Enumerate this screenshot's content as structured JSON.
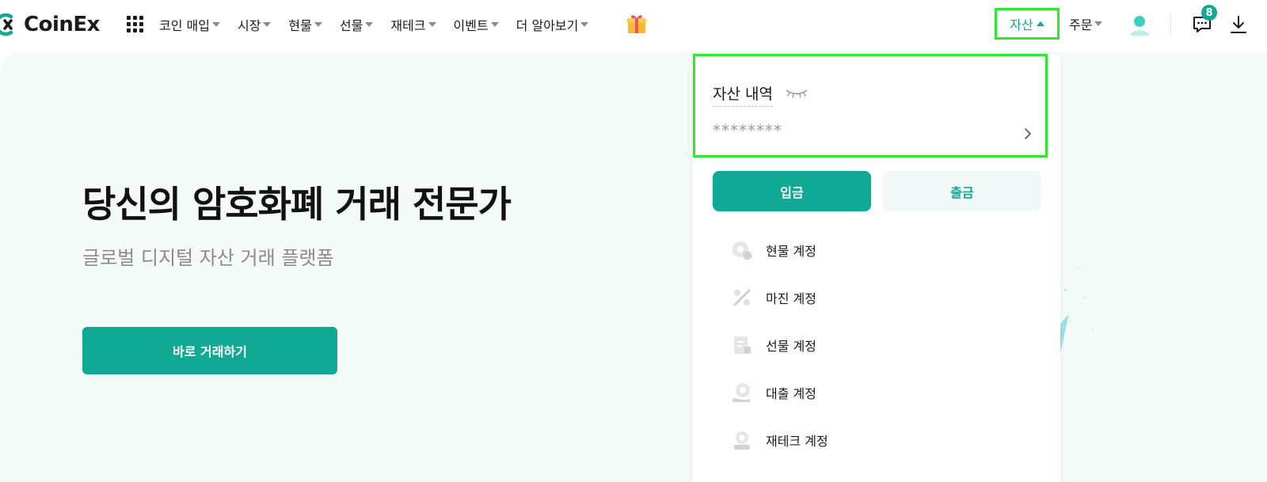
{
  "brand": {
    "name": "CoinEx",
    "accent": "#10a994"
  },
  "nav": {
    "items": [
      {
        "label": "코인 매입"
      },
      {
        "label": "시장"
      },
      {
        "label": "현물"
      },
      {
        "label": "선물"
      },
      {
        "label": "재테크"
      },
      {
        "label": "이벤트"
      },
      {
        "label": "더 알아보기"
      }
    ],
    "gift_icon": "gift-icon",
    "grid_icon": "apps-grid-icon"
  },
  "header_right": {
    "assets_label": "자산",
    "orders_label": "주문",
    "chat_badge": "8",
    "icons": [
      "avatar-icon",
      "chat-icon",
      "download-icon"
    ]
  },
  "hero": {
    "title": "당신의 암호화폐 거래 전문가",
    "subtitle": "글로벌 디지털 자산 거래 플랫폼",
    "cta_label": "바로 거래하기"
  },
  "assets_dropdown": {
    "summary_label": "자산 내역",
    "summary_value": "********",
    "deposit_label": "입금",
    "withdraw_label": "출금",
    "accounts": [
      {
        "label": "현물 계정",
        "icon": "spot-account-icon"
      },
      {
        "label": "마진 계정",
        "icon": "margin-account-icon"
      },
      {
        "label": "선물 계정",
        "icon": "futures-account-icon"
      },
      {
        "label": "대출 계정",
        "icon": "loan-account-icon"
      },
      {
        "label": "재테크 계정",
        "icon": "finance-account-icon"
      }
    ]
  },
  "colors": {
    "highlight": "#2ee82e",
    "hero_bg": "#f3fbf9",
    "button_secondary_bg": "#f1f8f7"
  }
}
